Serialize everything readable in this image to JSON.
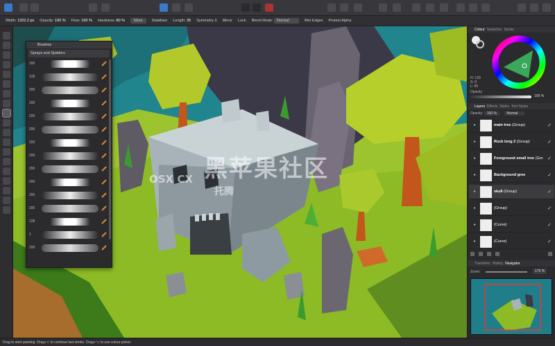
{
  "context_toolbar": {
    "width_label": "Width:",
    "width_value": "1322.2 px",
    "opacity_label": "Opacity:",
    "opacity_value": "100 %",
    "flow_label": "Flow:",
    "flow_value": "100 %",
    "hardness_label": "Hardness:",
    "hardness_value": "80 %",
    "more_label": "More",
    "stabiliser_label": "Stabiliser",
    "length_label": "Length:",
    "length_value": "35",
    "symmetry_label": "Symmetry",
    "symmetry_value": "1",
    "mirror_label": "Mirror",
    "lock_label": "Lock",
    "blend_label": "Blend Mode:",
    "blend_value": "Normal",
    "wet_edges_label": "Wet Edges",
    "protect_alpha_label": "Protect Alpha"
  },
  "brushes_panel": {
    "title": "Brushes",
    "category": "Sprays and Spatters",
    "sizes": [
      "200",
      "128",
      "200",
      "200",
      "200",
      "200",
      "200",
      "200",
      "200",
      "200",
      "200",
      "200",
      "128",
      "1",
      "200"
    ]
  },
  "colour_panel": {
    "tabs": [
      "Colour",
      "Swatches",
      "Stroke"
    ],
    "h_value": "H: 139",
    "s_value": "S: 9",
    "l_value": "L: 65",
    "opacity_label": "Opacity",
    "opacity_value": "100 %"
  },
  "layers_panel": {
    "tabs": [
      "Layers",
      "Effects",
      "Styles",
      "Text Styles"
    ],
    "opacity_label": "Opacity:",
    "opacity_value": "100 %",
    "blend_value": "Normal",
    "layers": [
      {
        "name": "main tree",
        "type": "(Group)"
      },
      {
        "name": "Rock long 2",
        "type": "(Group)"
      },
      {
        "name": "Foreground small tree",
        "type": "(Gro"
      },
      {
        "name": "Background gree",
        "type": ""
      },
      {
        "name": "skull",
        "type": "(Group)"
      },
      {
        "name": "",
        "type": "(Group)"
      },
      {
        "name": "",
        "type": "(Curve)"
      },
      {
        "name": "",
        "type": "(Curve)"
      }
    ]
  },
  "navigator_panel": {
    "tabs": [
      "Transform",
      "History",
      "Navigator"
    ],
    "zoom_label": "Zoom:",
    "zoom_value": "179 %"
  },
  "status_bar": {
    "text": "Drag to start painting. Drag+⇧ to continue last stroke. Drag+⌥ to use colour picker."
  },
  "watermark": {
    "text_cn": "黑苹果社区",
    "text_en": "OSX CX",
    "text_small": "托腾"
  },
  "colors": {
    "toolbar_bg": "#38383c",
    "panel_bg": "#2b2b2e",
    "accent": "#3b79c9",
    "grass": "#9ac232",
    "teal_bg": "#21858d"
  }
}
